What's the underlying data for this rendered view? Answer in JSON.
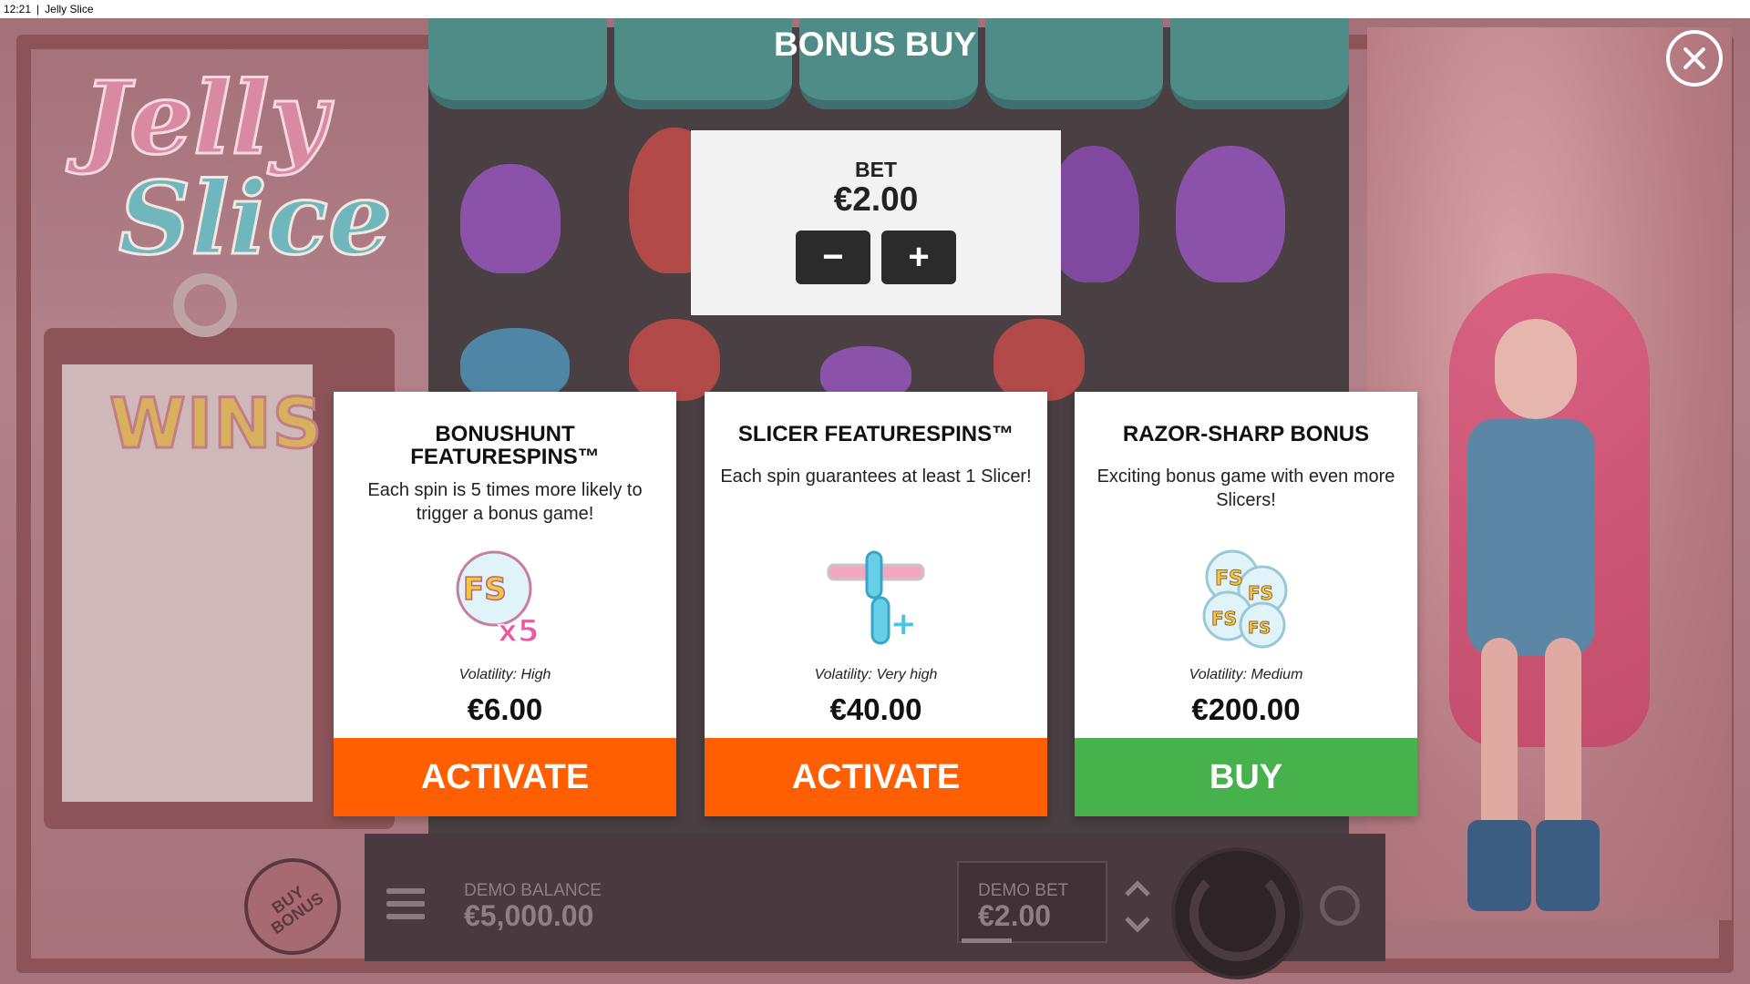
{
  "titlebar": {
    "time": "12:21",
    "separator": "|",
    "app": "Jelly Slice"
  },
  "logo": {
    "line1": "Jelly",
    "line2": "Slice"
  },
  "wins_label": "WINS",
  "modal": {
    "title": "BONUS BUY",
    "bet": {
      "label": "BET",
      "amount": "€2.00",
      "minus": "−",
      "plus": "+"
    },
    "cards": [
      {
        "title": "BONUSHUNT FEATURESPINS™",
        "description": "Each spin is 5 times more likely to trigger a bonus game!",
        "icon": "fs-x5-icon",
        "volatility": "Volatility: High",
        "price": "€6.00",
        "button": "ACTIVATE",
        "button_color": "#ff5f00"
      },
      {
        "title": "SLICER FEATURESPINS™",
        "description": "Each spin guarantees at least 1 Slicer!",
        "icon": "slicer-plus-icon",
        "volatility": "Volatility: Very high",
        "price": "€40.00",
        "button": "ACTIVATE",
        "button_color": "#ff5f00"
      },
      {
        "title": "RAZOR-SHARP BONUS",
        "description": "Exciting bonus game with even more Slicers!",
        "icon": "fs-stack-icon",
        "volatility": "Volatility: Medium",
        "price": "€200.00",
        "button": "BUY",
        "button_color": "#47b14c"
      }
    ]
  },
  "bottom_bar": {
    "buy_bonus": "BUY BONUS",
    "balance_label": "DEMO BALANCE",
    "balance_value": "€5,000.00",
    "bet_label": "DEMO BET",
    "bet_value": "€2.00"
  },
  "colors": {
    "activate": "#ff5f00",
    "buy": "#47b14c",
    "panel": "#f2f2f2"
  }
}
